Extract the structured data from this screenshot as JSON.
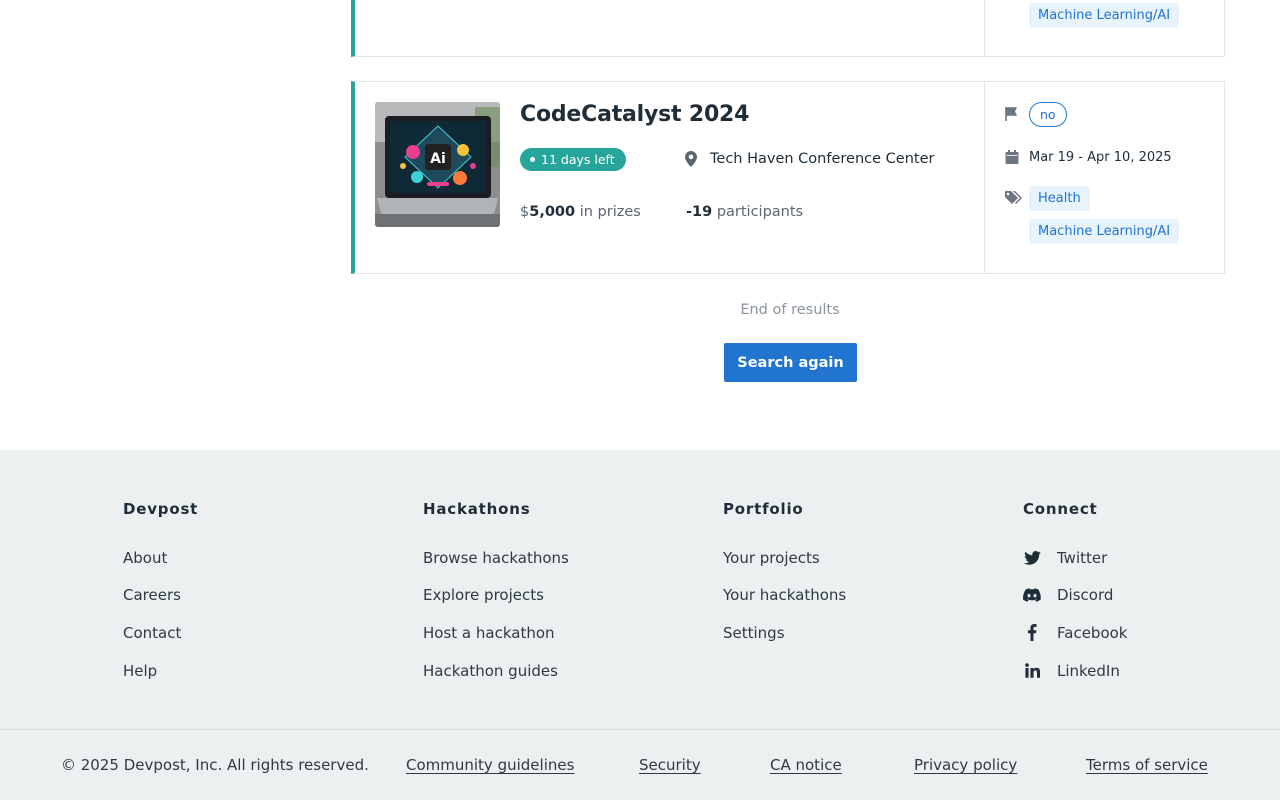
{
  "previous_card": {
    "tags": [
      "Machine Learning/AI"
    ]
  },
  "hackathon": {
    "title": "CodeCatalyst 2024",
    "status": "11 days left",
    "location": "Tech Haven Conference Center",
    "prize_currency": "$",
    "prize_amount": "5,000",
    "prize_suffix": "in prizes",
    "participants_count": "-19",
    "participants_label": "participants",
    "managed_by_devpost": "no",
    "dates": "Mar 19 - Apr 10, 2025",
    "themes": [
      "Health",
      "Machine Learning/AI"
    ],
    "thumbnail_text": "Ai"
  },
  "results": {
    "end_text": "End of results",
    "search_again_label": "Search again"
  },
  "footer": {
    "columns": [
      {
        "heading": "Devpost",
        "links": [
          "About",
          "Careers",
          "Contact",
          "Help"
        ]
      },
      {
        "heading": "Hackathons",
        "links": [
          "Browse hackathons",
          "Explore projects",
          "Host a hackathon",
          "Hackathon guides"
        ]
      },
      {
        "heading": "Portfolio",
        "links": [
          "Your projects",
          "Your hackathons",
          "Settings"
        ]
      },
      {
        "heading": "Connect",
        "links": [
          "Twitter",
          "Discord",
          "Facebook",
          "LinkedIn"
        ]
      }
    ],
    "copyright": "© 2025 Devpost, Inc. All rights reserved.",
    "legal_links": [
      "Community guidelines",
      "Security",
      "CA notice",
      "Privacy policy",
      "Terms of service"
    ]
  },
  "colors": {
    "accent_teal": "#26a69a",
    "link_blue": "#2174cf",
    "tag_bg": "#e9f3fc",
    "footer_bg": "#edf0f1"
  }
}
